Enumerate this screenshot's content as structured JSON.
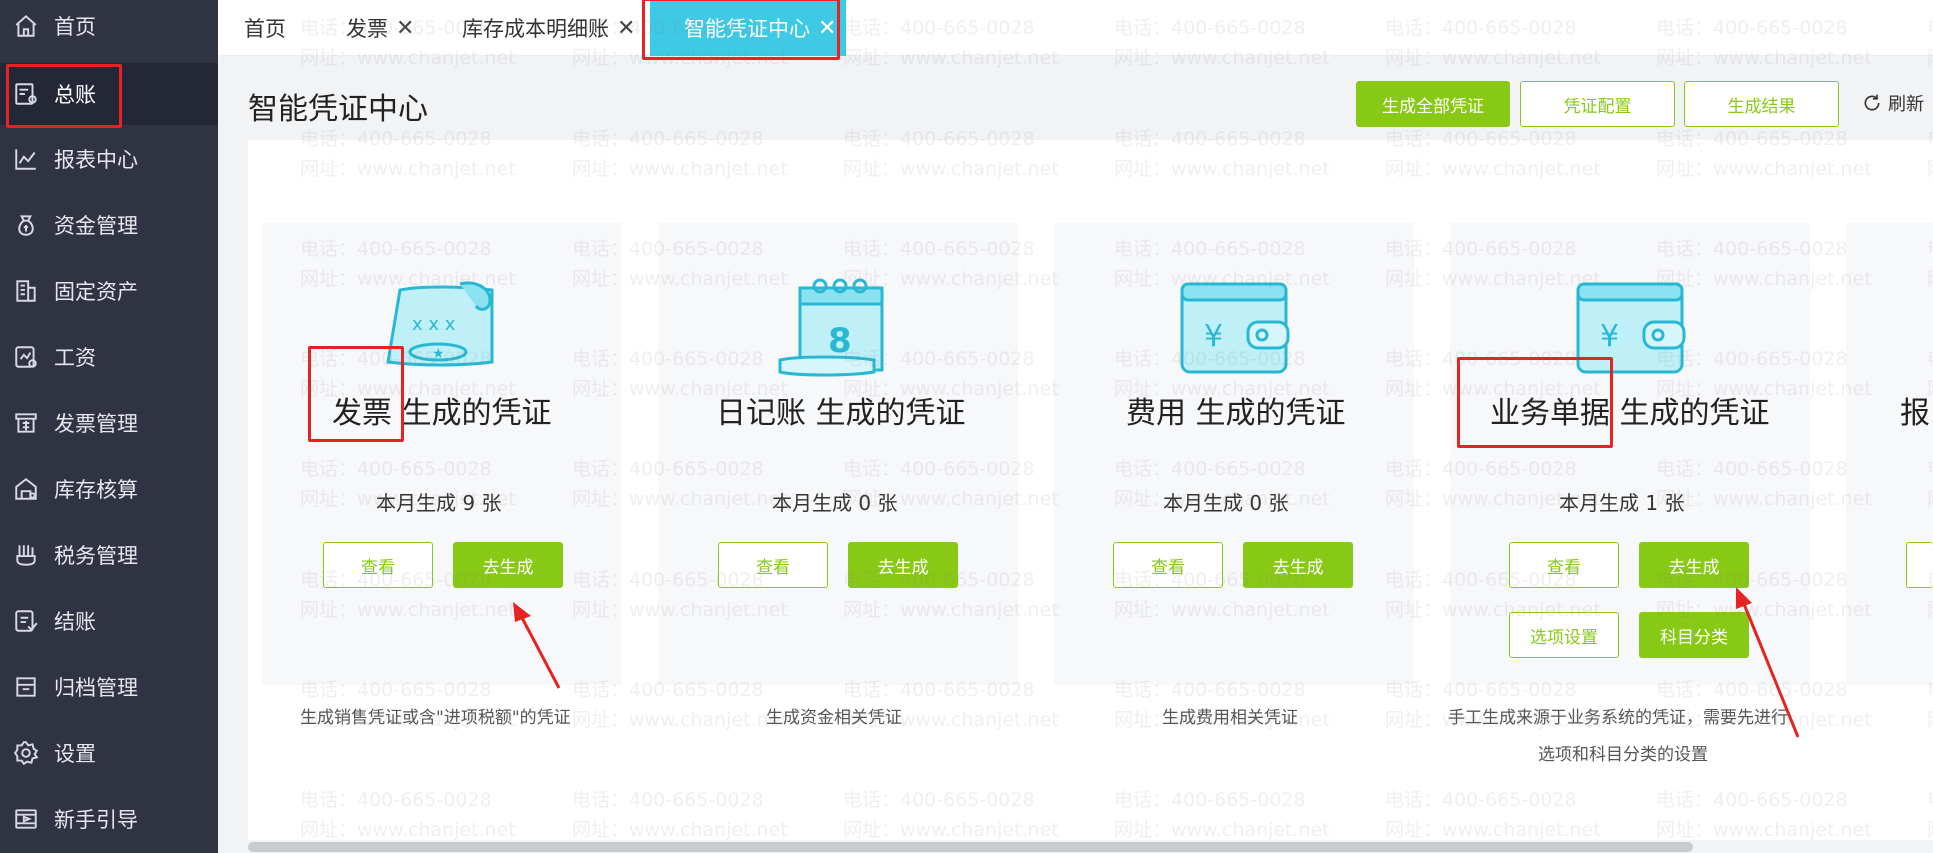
{
  "sidebar": {
    "items": [
      {
        "label": "首页",
        "icon": "home-icon"
      },
      {
        "label": "总账",
        "icon": "ledger-icon"
      },
      {
        "label": "报表中心",
        "icon": "chart-icon"
      },
      {
        "label": "资金管理",
        "icon": "money-bag-icon"
      },
      {
        "label": "固定资产",
        "icon": "building-icon"
      },
      {
        "label": "工资",
        "icon": "payroll-icon"
      },
      {
        "label": "发票管理",
        "icon": "invoice-icon"
      },
      {
        "label": "库存核算",
        "icon": "warehouse-icon"
      },
      {
        "label": "税务管理",
        "icon": "tax-icon"
      },
      {
        "label": "结账",
        "icon": "checkout-icon"
      },
      {
        "label": "归档管理",
        "icon": "archive-icon"
      },
      {
        "label": "设置",
        "icon": "gear-icon"
      },
      {
        "label": "新手引导",
        "icon": "guide-icon"
      }
    ],
    "active_index": 1
  },
  "tabs": [
    {
      "label": "首页",
      "closable": false
    },
    {
      "label": "发票",
      "closable": true
    },
    {
      "label": "库存成本明细账",
      "closable": true
    },
    {
      "label": "智能凭证中心",
      "closable": true,
      "active": true
    }
  ],
  "header": {
    "title": "智能凭证中心",
    "generate_all": "生成全部凭证",
    "config": "凭证配置",
    "result": "生成结果",
    "refresh": "刷新"
  },
  "cards": [
    {
      "title": "发票 生成的凭证",
      "count": "本月生成  9 张",
      "view": "查看",
      "generate": "去生成",
      "desc": "生成销售凭证或含\"进项税额\"的凭证",
      "icon": "invoice-card-icon"
    },
    {
      "title": "日记账 生成的凭证",
      "count": "本月生成  0 张",
      "view": "查看",
      "generate": "去生成",
      "desc": "生成资金相关凭证",
      "icon": "calendar-icon"
    },
    {
      "title": "费用 生成的凭证",
      "count": "本月生成   0 张",
      "view": "查看",
      "generate": "去生成",
      "desc": "生成费用相关凭证",
      "icon": "wallet-icon"
    },
    {
      "title": "业务单据 生成的凭证",
      "count": "本月生成   1 张",
      "view": "查看",
      "generate": "去生成",
      "options": "选项设置",
      "classify": "科目分类",
      "desc": "手工生成来源于业务系统的凭证，需要先进行",
      "desc2": "选项和科目分类的设置",
      "icon": "wallet-icon"
    },
    {
      "title": "报"
    }
  ],
  "watermark": {
    "phone": "电话：400-665-0028",
    "site": "网址：www.chanjet.net"
  },
  "colors": {
    "sidebar_bg": "#2f3342",
    "accent_green": "#88c916",
    "active_tab": "#3ec9e4",
    "annotation_red": "#e62222",
    "icon_cyan": "#4fd0e6"
  }
}
